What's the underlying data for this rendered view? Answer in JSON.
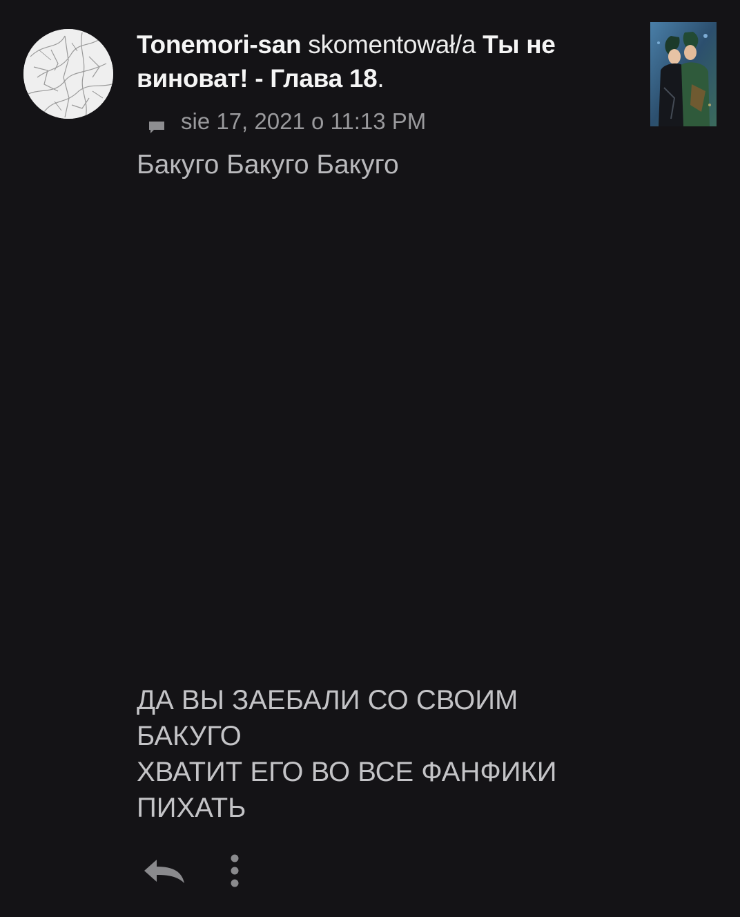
{
  "notification": {
    "username": "Tonemori-san",
    "action_text": "skomentował/a",
    "story_title": "Ты не виноват! - Глава 18",
    "title_suffix": ".",
    "timestamp": "sie 17, 2021 o 11:13 PM",
    "comment_line_1": "Бакуго Бакуго Бакуго",
    "comment_block": [
      "ДА ВЫ ЗАЕБАЛИ СО СВОИМ",
      "БАКУГО",
      "ХВАТИТ ЕГО ВО ВСЕ ФАНФИКИ",
      "ПИХАТЬ"
    ]
  },
  "icons": {
    "meta": "chat-bubble-icon",
    "reply": "reply-arrow-icon",
    "more": "more-vertical-icon"
  },
  "colors": {
    "background": "#141316",
    "primary_text": "#f5f5f5",
    "secondary_text": "#9a9a9d",
    "comment_text": "#c4c4c7"
  }
}
